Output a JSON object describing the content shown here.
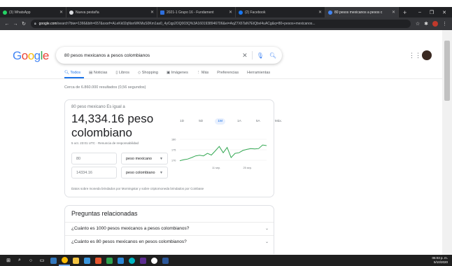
{
  "browser": {
    "tabs": [
      {
        "title": "(3) WhatsApp",
        "color": "#25d366",
        "active": false
      },
      {
        "title": "Nueva pestaña",
        "color": "#dadce0",
        "active": false
      },
      {
        "title": "2021-1 Grupo 16 - Fundament",
        "color": "#2d6fde",
        "active": false
      },
      {
        "title": "(2) Facebook",
        "color": "#1877f2",
        "active": false
      },
      {
        "title": "80 pesos mexicanos a pesos c",
        "color": "#4285f4",
        "active": true
      }
    ],
    "new_tab": "+",
    "window_controls": [
      "–",
      "❐",
      "✕"
    ],
    "url_host": "google.com",
    "url_path": "/search?biw=1366&bih=657&sxsrf=ALeKk02qNsnWKMuS0Km1as0_4yCqp2OQ003Q%3A1601938946706&ei=AqZ7X6TaN7EtQbvl4uACg&q=80+pesos+mexicanos..."
  },
  "google": {
    "logo": [
      "G",
      "o",
      "o",
      "g",
      "l",
      "e"
    ],
    "logo_colors": [
      "#4285f4",
      "#ea4335",
      "#fbbc05",
      "#4285f4",
      "#34a853",
      "#ea4335"
    ],
    "query": "80 pesos mexicanos a pesos colombianos",
    "filters": [
      "Todos",
      "Noticias",
      "Libros",
      "Shopping",
      "Imágenes",
      "Más",
      "Preferencias",
      "Herramientas"
    ],
    "filter_icons": [
      "search-icon",
      "news-icon",
      "book-icon",
      "tag-icon",
      "image-icon",
      "more-icon",
      "",
      ""
    ],
    "stats": "Cerca de 6.860.000 resultados (0,56 segundos)"
  },
  "converter": {
    "label": "80 peso mexicano Es igual a",
    "result": "14,334.16 peso colombiano",
    "time": "5 oct. 23:01 UTC · Renuncia de responsabilidad",
    "from_amount": "80",
    "from_unit": "peso mexicano",
    "to_amount": "14334.16",
    "to_unit": "peso colombiano",
    "disclaimer": "Datos sobre moneda brindados por Morningstar y sobre criptomoneda brindados por Coinbase",
    "ranges": [
      "1D",
      "5D",
      "1M",
      "1A",
      "5A",
      "Máx."
    ],
    "active_range": "1M"
  },
  "chart_data": {
    "type": "line",
    "x_tick_labels": [
      "11 sep.",
      "25 sep."
    ],
    "y_tick_labels": [
      "180",
      "175",
      "170"
    ],
    "ylim": [
      168,
      182
    ],
    "values": [
      169.8,
      170.3,
      170.6,
      171.3,
      172.1,
      172.4,
      172.1,
      173.3,
      172.5,
      174.5,
      176.6,
      173.6,
      176.1,
      171.3,
      173.3,
      173.6,
      174.7,
      175.2,
      175.6,
      175.4,
      175.6,
      177.3,
      177.0
    ],
    "color": "#34a853",
    "grid": true
  },
  "related": {
    "title": "Preguntas relacionadas",
    "questions": [
      "¿Cuánto es 1000 pesos mexicanos a pesos colombianos?",
      "¿Cuánto es 80 pesos mexicanos en pesos colombianos?"
    ]
  },
  "taskbar": {
    "items": [
      {
        "name": "start-button",
        "color": "#ffffff"
      },
      {
        "name": "search-taskbar",
        "color": "#ffffff"
      },
      {
        "name": "cortana",
        "color": "#ffffff"
      },
      {
        "name": "task-view",
        "color": "#ffffff"
      },
      {
        "name": "edge-app",
        "color": "#3277bc"
      },
      {
        "name": "chrome-app",
        "color": "#fbbc05"
      },
      {
        "name": "explorer-app",
        "color": "#f4c542"
      },
      {
        "name": "store-app",
        "color": "#3a96dd"
      },
      {
        "name": "mail-app",
        "color": "#e8562e"
      },
      {
        "name": "app-green",
        "color": "#2ea44f"
      },
      {
        "name": "app-blue",
        "color": "#2b88d8"
      },
      {
        "name": "app-teal",
        "color": "#00b7c3"
      },
      {
        "name": "app-purple",
        "color": "#5c2d91"
      },
      {
        "name": "app-white",
        "color": "#ffffff"
      },
      {
        "name": "word-app",
        "color": "#2b579a"
      }
    ],
    "time": "06:03 p. m.",
    "date": "5/10/2020"
  }
}
